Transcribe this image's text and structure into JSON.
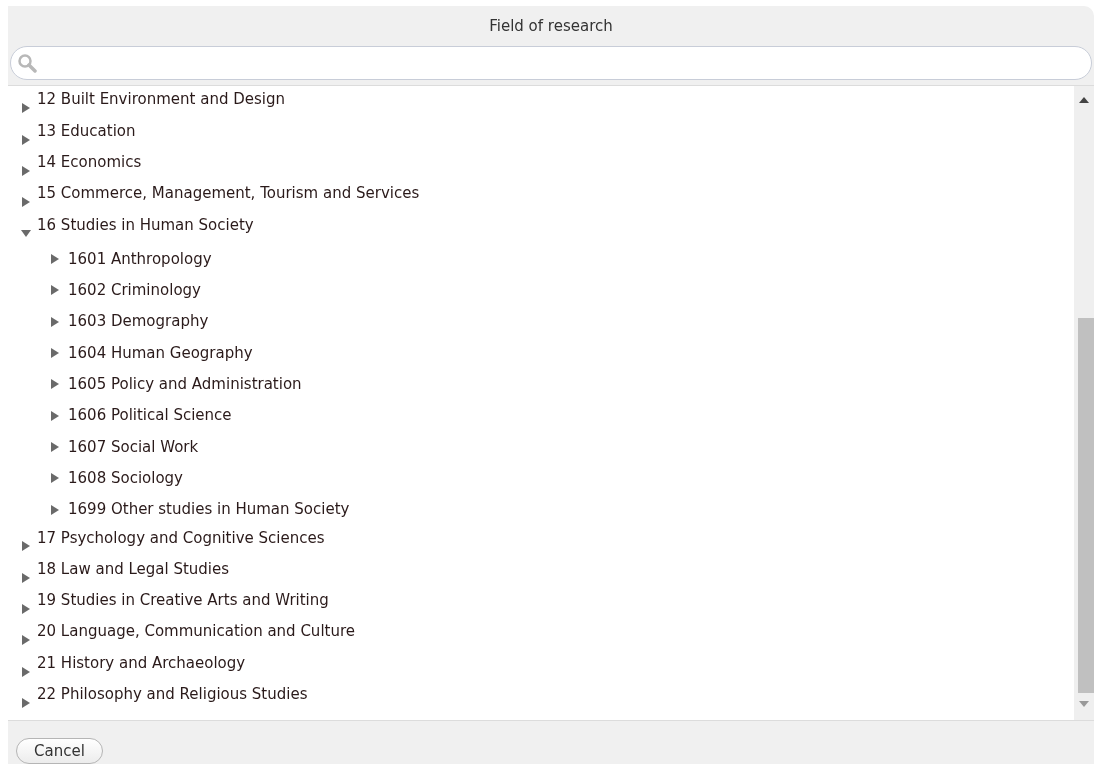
{
  "dialog": {
    "title": "Field of research"
  },
  "tree": {
    "items": [
      {
        "label": "12 Built Environment and Design",
        "expanded": false
      },
      {
        "label": "13 Education",
        "expanded": false
      },
      {
        "label": "14 Economics",
        "expanded": false
      },
      {
        "label": "15 Commerce, Management, Tourism and Services",
        "expanded": false
      },
      {
        "label": "16 Studies in Human Society",
        "expanded": true,
        "children": [
          {
            "label": "1601 Anthropology",
            "expanded": false
          },
          {
            "label": "1602 Criminology",
            "expanded": false
          },
          {
            "label": "1603 Demography",
            "expanded": false
          },
          {
            "label": "1604 Human Geography",
            "expanded": false
          },
          {
            "label": "1605 Policy and Administration",
            "expanded": false
          },
          {
            "label": "1606 Political Science",
            "expanded": false
          },
          {
            "label": "1607 Social Work",
            "expanded": false
          },
          {
            "label": "1608 Sociology",
            "expanded": false
          },
          {
            "label": "1699 Other studies in Human Society",
            "expanded": false
          }
        ]
      },
      {
        "label": "17 Psychology and Cognitive Sciences",
        "expanded": false
      },
      {
        "label": "18 Law and Legal Studies",
        "expanded": false
      },
      {
        "label": "19 Studies in Creative Arts and Writing",
        "expanded": false
      },
      {
        "label": "20 Language, Communication and Culture",
        "expanded": false
      },
      {
        "label": "21 History and Archaeology",
        "expanded": false
      },
      {
        "label": "22 Philosophy and Religious Studies",
        "expanded": false
      }
    ]
  },
  "footer": {
    "buttons": [
      "Cancel"
    ]
  }
}
